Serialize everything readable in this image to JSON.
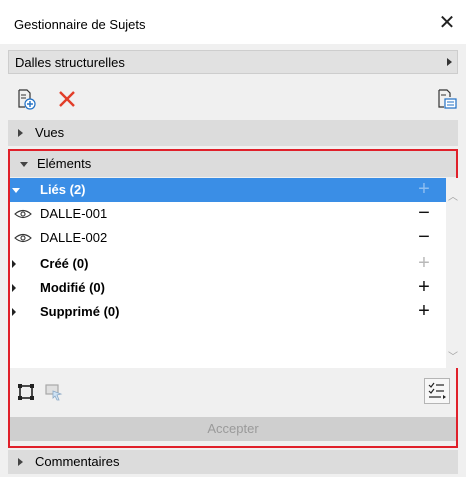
{
  "window": {
    "title": "Gestionnaire de Sujets",
    "close_glyph": "✕"
  },
  "selector": {
    "value": "Dalles structurelles"
  },
  "toolbar": {
    "new_topic_icon": "new-topic-icon",
    "delete_icon": "delete-icon",
    "export_icon": "export-icon",
    "delete_color": "#e23d28"
  },
  "sections": {
    "views": "Vues",
    "elements": "Eléments",
    "comments": "Commentaires"
  },
  "elements": {
    "groups": [
      {
        "label": "Liés (2)",
        "action": "+",
        "expanded": true,
        "selected": true
      },
      {
        "label": "Créé (0)",
        "action": "+"
      },
      {
        "label": "Modifié (0)",
        "action": "+"
      },
      {
        "label": "Supprimé (0)",
        "action": "+"
      }
    ],
    "items": [
      {
        "label": "DALLE-001",
        "action": "−"
      },
      {
        "label": "DALLE-002",
        "action": "−"
      }
    ]
  },
  "bottom": {
    "accept_label": "Accepter"
  },
  "colors": {
    "selection": "#3a8ee6",
    "highlight_frame": "#e0202a"
  }
}
